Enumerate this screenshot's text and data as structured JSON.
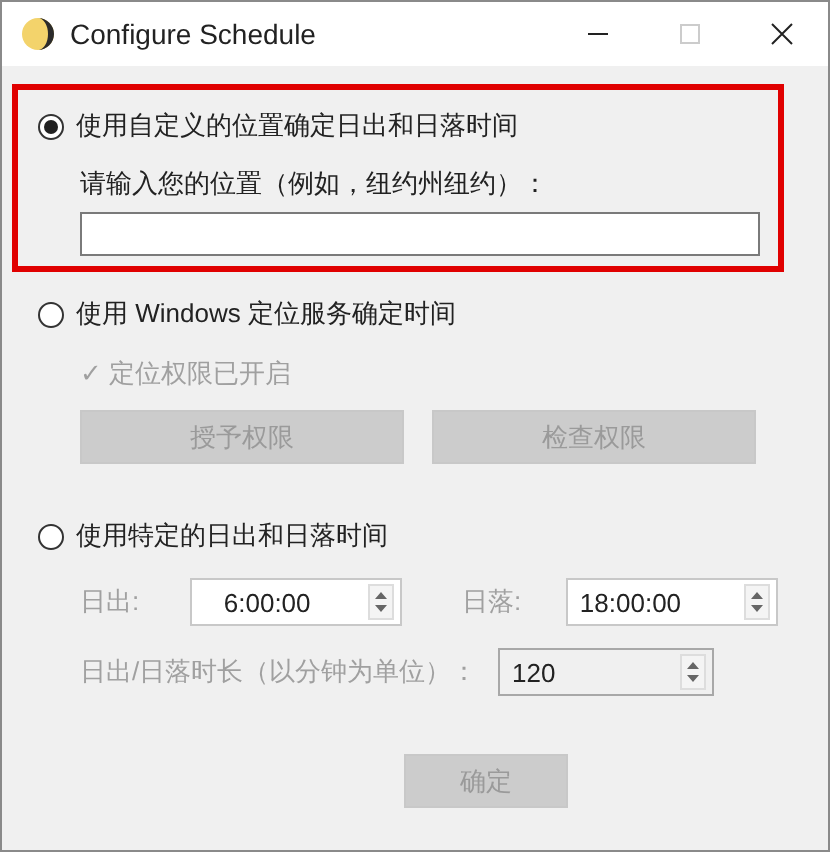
{
  "window": {
    "title": "Configure Schedule"
  },
  "options": [
    {
      "kind": "location",
      "label": "使用自定义的位置确定日出和日落时间",
      "selected": true,
      "highlighted": true,
      "prompt": "请输入您的位置（例如，纽约州纽约）："
    },
    {
      "kind": "windows",
      "label": "使用 Windows 定位服务确定时间",
      "selected": false,
      "disabled": true,
      "status": "✓ 定位权限已开启",
      "buttons": [
        "授予权限",
        "检查权限"
      ]
    },
    {
      "kind": "manual",
      "label": "使用特定的日出和日落时间",
      "selected": false,
      "disabled": true,
      "sunrise": {
        "label": "日出:",
        "value": "6:00:00"
      },
      "sunset": {
        "label": "日落:",
        "value": "18:00:00"
      },
      "duration": {
        "label": "日出/日落时长（以分钟为单位）：",
        "value": "120"
      }
    }
  ],
  "ok_button": {
    "label": "确定",
    "disabled": true
  }
}
